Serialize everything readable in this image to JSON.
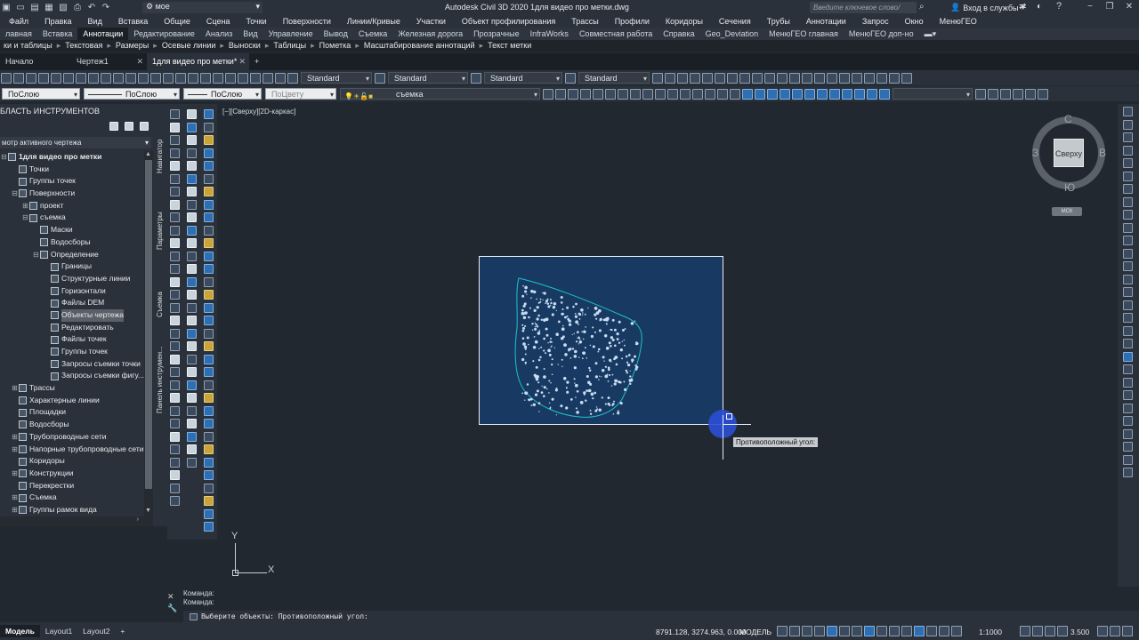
{
  "titlebar": {
    "workspace": "мое",
    "app_title": "Autodesk Civil 3D 2020    1для видео про метки.dwg",
    "search_placeholder": "Введите ключевое слово/фразу",
    "signin": "Вход в службы"
  },
  "menubar": [
    "Файл",
    "Правка",
    "Вид",
    "Вставка",
    "Общие",
    "Сцена",
    "Точки",
    "Поверхности",
    "Линии/Кривые",
    "Участки",
    "Объект профилирования",
    "Трассы",
    "Профили",
    "Коридоры",
    "Сечения",
    "Трубы",
    "Аннотации",
    "Запрос",
    "Окно",
    "МенюГЕО"
  ],
  "ribbon_tabs": [
    {
      "label": "лавная",
      "active": false
    },
    {
      "label": "Вставка",
      "active": false
    },
    {
      "label": "Аннотации",
      "active": true
    },
    {
      "label": "Редактирование",
      "active": false
    },
    {
      "label": "Анализ",
      "active": false
    },
    {
      "label": "Вид",
      "active": false
    },
    {
      "label": "Управление",
      "active": false
    },
    {
      "label": "Вывод",
      "active": false
    },
    {
      "label": "Съемка",
      "active": false
    },
    {
      "label": "Железная дорога",
      "active": false
    },
    {
      "label": "Прозрачные",
      "active": false
    },
    {
      "label": "InfraWorks",
      "active": false
    },
    {
      "label": "Совместная работа",
      "active": false
    },
    {
      "label": "Справка",
      "active": false
    },
    {
      "label": "Geo_Deviation",
      "active": false
    },
    {
      "label": "МенюГЕО главная",
      "active": false
    },
    {
      "label": "МенюГЕО доп-но",
      "active": false
    }
  ],
  "ribbon_panels": [
    "ки и таблицы",
    "Текстовая",
    "Размеры",
    "Осевые линии",
    "Выноски",
    "Таблицы",
    "Пометка",
    "Масштабирование аннотаций",
    "Текст метки"
  ],
  "doc_tabs": [
    {
      "label": "Начало",
      "active": false,
      "close": false
    },
    {
      "label": "Чертеж1",
      "active": false,
      "close": true
    },
    {
      "label": "1для видео про метки*",
      "active": true,
      "close": true
    }
  ],
  "toolbar1": {
    "style_combos": [
      "Standard",
      "Standard",
      "Standard",
      "Standard"
    ]
  },
  "toolbar2": {
    "color_combo": "ПоСлою",
    "linetype_combo": "ПоСлою",
    "lineweight_combo": "ПоСлою",
    "plotstyle_combo": "ПоЦвету",
    "layer_combo": "съемка"
  },
  "palette": {
    "title": "БЛАСТЬ ИНСТРУМЕНТОВ",
    "prev_label": "смотр",
    "dropdown": "мотр активного чертежа",
    "tree": [
      {
        "label": "1для видео про метки",
        "level": 0,
        "toggle": "−",
        "bold": true
      },
      {
        "label": "Точки",
        "level": 1,
        "toggle": ""
      },
      {
        "label": "Группы точек",
        "level": 1,
        "toggle": ""
      },
      {
        "label": "Поверхности",
        "level": 1,
        "toggle": "−"
      },
      {
        "label": "проект",
        "level": 2,
        "toggle": "+"
      },
      {
        "label": "съемка",
        "level": 2,
        "toggle": "−"
      },
      {
        "label": "Маски",
        "level": 3,
        "toggle": ""
      },
      {
        "label": "Водосборы",
        "level": 3,
        "toggle": ""
      },
      {
        "label": "Определение",
        "level": 3,
        "toggle": "−"
      },
      {
        "label": "Границы",
        "level": 4,
        "toggle": ""
      },
      {
        "label": "Структурные линии",
        "level": 4,
        "toggle": ""
      },
      {
        "label": "Горизонтали",
        "level": 4,
        "toggle": ""
      },
      {
        "label": "Файлы DEM",
        "level": 4,
        "toggle": ""
      },
      {
        "label": "Объекты чертежа",
        "level": 4,
        "toggle": "",
        "selected": true
      },
      {
        "label": "Редактировать",
        "level": 4,
        "toggle": ""
      },
      {
        "label": "Файлы точек",
        "level": 4,
        "toggle": ""
      },
      {
        "label": "Группы точек",
        "level": 4,
        "toggle": ""
      },
      {
        "label": "Запросы съемки точки",
        "level": 4,
        "toggle": ""
      },
      {
        "label": "Запросы съемки фигу...",
        "level": 4,
        "toggle": ""
      },
      {
        "label": "Трассы",
        "level": 1,
        "toggle": "+"
      },
      {
        "label": "Характерные линии",
        "level": 1,
        "toggle": ""
      },
      {
        "label": "Площадки",
        "level": 1,
        "toggle": ""
      },
      {
        "label": "Водосборы",
        "level": 1,
        "toggle": ""
      },
      {
        "label": "Трубопроводные сети",
        "level": 1,
        "toggle": "+"
      },
      {
        "label": "Напорные трубопроводные сети",
        "level": 1,
        "toggle": "+"
      },
      {
        "label": "Коридоры",
        "level": 1,
        "toggle": ""
      },
      {
        "label": "Конструкции",
        "level": 1,
        "toggle": "+"
      },
      {
        "label": "Перекрестки",
        "level": 1,
        "toggle": ""
      },
      {
        "label": "Съемка",
        "level": 1,
        "toggle": "+"
      },
      {
        "label": "Группы рамок вида",
        "level": 1,
        "toggle": "+"
      }
    ]
  },
  "side_tabs": [
    "Навигатор",
    "Параметры",
    "Съемка",
    "Панель инструмен..."
  ],
  "canvas": {
    "view_label": "[−][Сверху][2D-каркас]",
    "tooltip": "Противоположный угол:",
    "viewcube": {
      "top": "Сверху",
      "north": "С",
      "south": "Ю",
      "west": "З",
      "east": "В",
      "ucs": "МСК"
    },
    "ucs_x": "X",
    "ucs_y": "Y"
  },
  "command": {
    "history": [
      "Команда:",
      "Команда:"
    ],
    "prompt": "Выберите объекты: Противоположный угол:"
  },
  "status": {
    "layout_tabs": [
      {
        "label": "Модель",
        "active": true
      },
      {
        "label": "Layout1",
        "active": false
      },
      {
        "label": "Layout2",
        "active": false
      }
    ],
    "add_tab": "+",
    "coords": "8791.128, 3274.963, 0.000",
    "model": "МОДЕЛЬ",
    "scale": "1:1000",
    "lineweight": "3.500"
  },
  "colors": {
    "accent_blue": "#2b4fd6",
    "boundary_cyan": "#1fc2c8",
    "window_fill": "#183a62"
  }
}
